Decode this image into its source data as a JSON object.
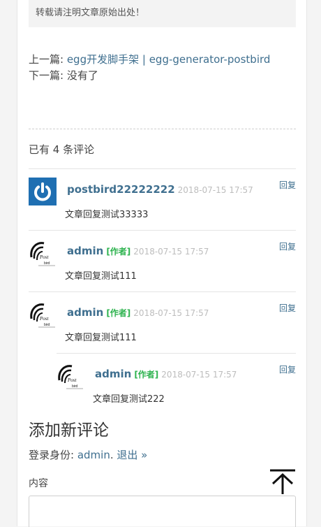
{
  "notice": "转载请注明文章原始出处！",
  "nav": {
    "prev_label": "上一篇: ",
    "prev_link": "egg开发脚手架 | egg-generator-postbird",
    "next_label": "下一篇: ",
    "next_text": "没有了"
  },
  "comments_count": "已有 4 条评论",
  "comments": [
    {
      "author": "postbird22222222",
      "badge": "",
      "time": "2018-07-15 17:57",
      "text": "文章回复测试33333",
      "reply": "回复",
      "avatar": "power-icon"
    },
    {
      "author": "admin",
      "badge": "[作者]",
      "time": "2018-07-15 17:57",
      "text": "文章回复测试111",
      "reply": "回复",
      "avatar": "postbird-logo"
    },
    {
      "author": "admin",
      "badge": "[作者]",
      "time": "2018-07-15 17:57",
      "text": "文章回复测试111",
      "reply": "回复",
      "avatar": "postbird-logo"
    },
    {
      "author": "admin",
      "badge": "[作者]",
      "time": "2018-07-15 17:57",
      "text": "文章回复测试222",
      "reply": "回复",
      "avatar": "postbird-logo"
    }
  ],
  "add_comment": {
    "title": "添加新评论",
    "login_prefix": "登录身份: ",
    "login_user": "admin",
    "login_sep": ". ",
    "logout": "退出 »",
    "content_label": "内容"
  },
  "colors": {
    "link": "#3f6f8f",
    "author_badge": "#2eb34f",
    "avatar_blue": "#1f6fb2"
  },
  "icons": {
    "back_to_top": "arrow-up-to-line-icon"
  }
}
